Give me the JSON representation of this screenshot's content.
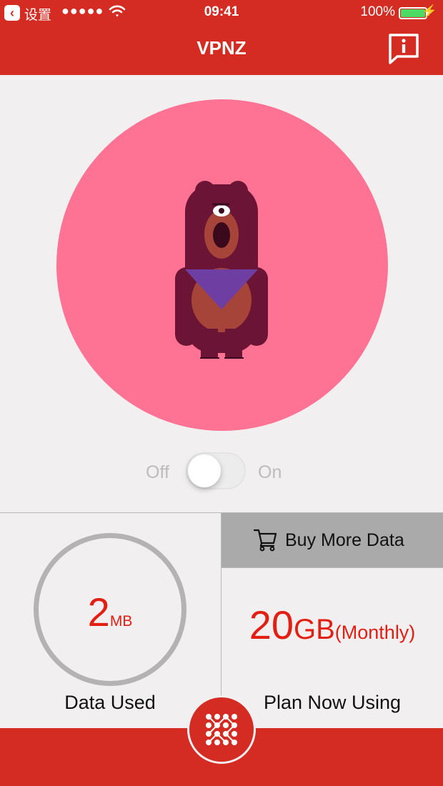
{
  "status_bar": {
    "back_label": "设置",
    "signal": "●●●●●",
    "time": "09:41",
    "battery_percent": "100%",
    "battery_level": 1.0
  },
  "nav": {
    "title": "VPNZ",
    "info_icon": "info-speech-bubble-icon"
  },
  "hero": {
    "illustration": "bear-mascot",
    "circle_color": "#fe7393"
  },
  "toggle": {
    "off_label": "Off",
    "on_label": "On",
    "state": "off"
  },
  "data_used": {
    "value": "2",
    "unit": "MB",
    "label": "Data Used"
  },
  "plan": {
    "buy_label": "Buy More Data",
    "cart_icon": "cart-icon",
    "value": "20",
    "unit": "GB",
    "period": "(Monthly)",
    "label": "Plan Now Using"
  },
  "colors": {
    "brand_red": "#d42b22",
    "value_red": "#e31e12",
    "pink": "#fe7393"
  }
}
